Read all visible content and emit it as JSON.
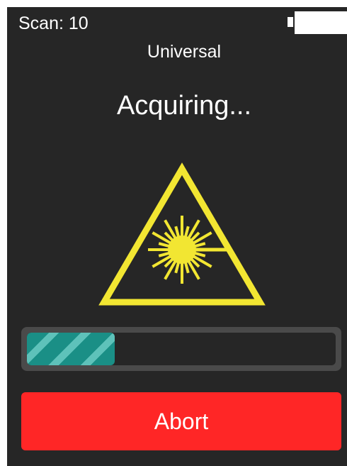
{
  "status_bar": {
    "scan_counter": "Scan: 10",
    "battery_icon": "battery-icon"
  },
  "mode_label": "Universal",
  "status_text": "Acquiring...",
  "warning_icon": "laser-warning-icon",
  "progress": {
    "fraction": 0.285
  },
  "abort_label": "Abort",
  "colors": {
    "background": "#262626",
    "warning_yellow": "#f2e632",
    "progress_fill": "#1a8f86",
    "progress_stripe": "#5ec2ba",
    "abort_button": "#ff2626",
    "text": "#ffffff"
  }
}
